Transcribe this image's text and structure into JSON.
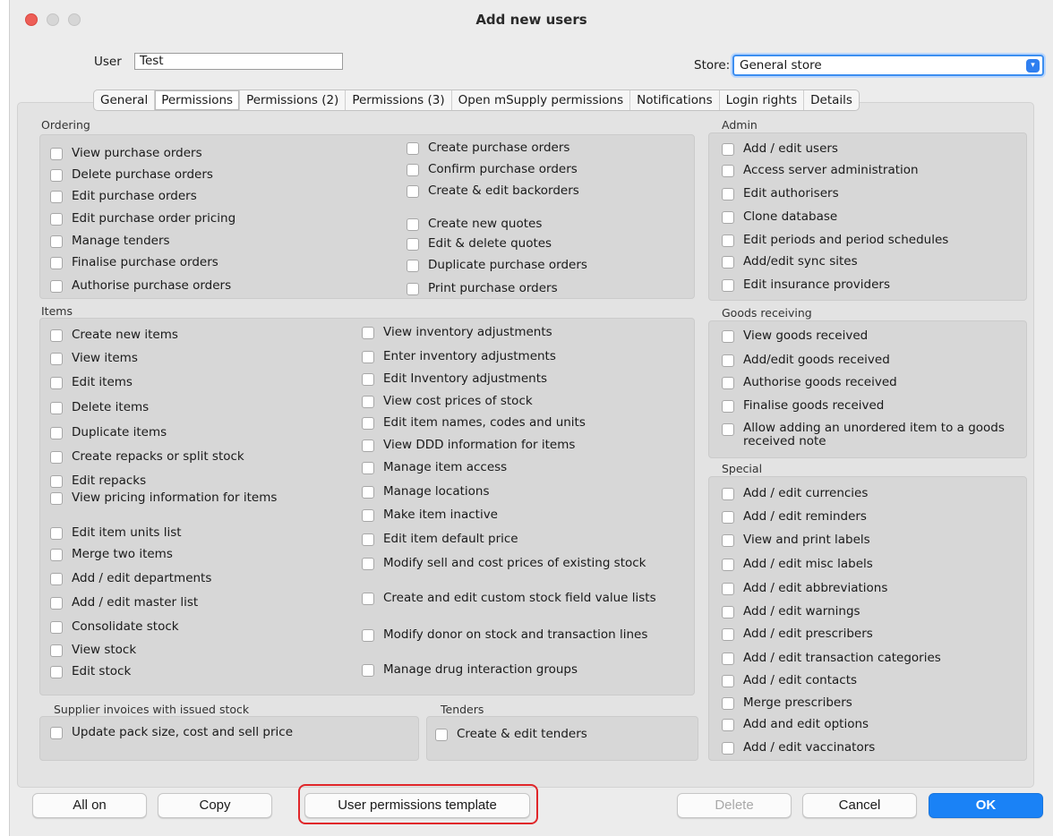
{
  "window": {
    "title": "Add new users"
  },
  "header": {
    "user_label": "User",
    "user_value": "Test",
    "store_label": "Store:",
    "store_value": "General store"
  },
  "tabs": [
    "General",
    "Permissions",
    "Permissions (2)",
    "Permissions (3)",
    "Open mSupply permissions",
    "Notifications",
    "Login rights",
    "Details"
  ],
  "active_tab": "Permissions",
  "ordering": {
    "title": "Ordering",
    "left": [
      "View purchase orders",
      "Delete purchase orders",
      "Edit purchase orders",
      "Edit purchase order pricing",
      "Manage tenders",
      "Finalise purchase orders",
      "Authorise purchase orders"
    ],
    "right": [
      "Create purchase orders",
      "Confirm purchase orders",
      "Create & edit backorders",
      "Create new quotes",
      "Edit & delete quotes",
      "Duplicate purchase orders",
      "Print purchase orders"
    ]
  },
  "items": {
    "title": "Items",
    "left": [
      "Create new items",
      "View items",
      "Edit items",
      "Delete items",
      "Duplicate items",
      "Create repacks or split stock",
      "Edit repacks",
      "View pricing information for items",
      "Edit item units list",
      "Merge two items",
      "Add / edit departments",
      "Add / edit master list",
      "Consolidate stock",
      "View stock",
      "Edit stock"
    ],
    "right": [
      "View inventory adjustments",
      "Enter inventory adjustments",
      "Edit Inventory adjustments",
      "View cost prices of stock",
      "Edit item names, codes and units",
      "View DDD information for items",
      "Manage item access",
      "Manage locations",
      "Make item inactive",
      "Edit item default price",
      "Modify sell and cost prices of existing stock",
      "Create and edit custom stock field value lists",
      "Modify donor on stock and transaction lines",
      "Manage drug interaction groups"
    ]
  },
  "supplier": {
    "title": "Supplier invoices with issued stock",
    "items": [
      "Update pack size, cost and sell price"
    ]
  },
  "tenders": {
    "title": "Tenders",
    "items": [
      "Create & edit tenders"
    ]
  },
  "admin": {
    "title": "Admin",
    "items": [
      "Add / edit users",
      "Access server administration",
      "Edit authorisers",
      "Clone database",
      "Edit periods and period schedules",
      "Add/edit sync sites",
      "Edit insurance providers"
    ]
  },
  "goods": {
    "title": "Goods receiving",
    "items": [
      "View goods received",
      "Add/edit goods received",
      "Authorise goods received",
      "Finalise goods received",
      "Allow adding an unordered item to a goods received note"
    ]
  },
  "special": {
    "title": "Special",
    "items": [
      "Add / edit currencies",
      "Add / edit reminders",
      "View and print labels",
      "Add / edit misc labels",
      "Add / edit abbreviations",
      "Add / edit warnings",
      "Add / edit prescribers",
      "Add / edit transaction categories",
      "Add / edit contacts",
      "Merge prescribers",
      "Add and edit options",
      "Add / edit vaccinators"
    ]
  },
  "buttons": {
    "all_on": "All on",
    "copy": "Copy",
    "template": "User permissions template",
    "delete": "Delete",
    "cancel": "Cancel",
    "ok": "OK"
  },
  "colors": {
    "accent": "#1a82f6",
    "highlight": "#e0262a"
  }
}
